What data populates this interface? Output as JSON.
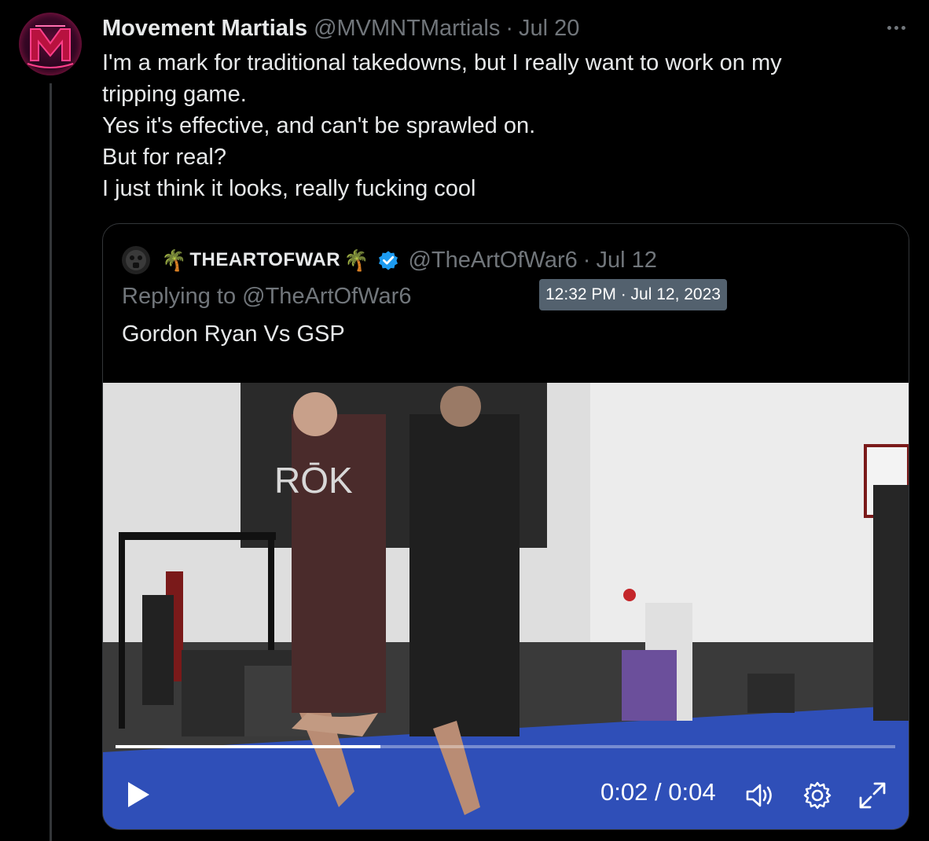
{
  "tweet": {
    "author_name": "Movement Martials",
    "author_handle": "@MVMNTMartials",
    "separator": "·",
    "date": "Jul 20",
    "avatar_icon": "mm-logo-icon",
    "more_icon": "more-icon",
    "lines": [
      "I'm a mark for traditional takedowns, but I really want to work on my",
      "tripping game.",
      "Yes it's effective, and can't be sprawled on.",
      "But for real?",
      "I just think it looks, really fucking cool"
    ]
  },
  "quote": {
    "palm_left": "🌴",
    "author_name": "THEARTOFWAR",
    "palm_right": "🌴",
    "verified_icon": "verified-badge-icon",
    "author_handle": "@TheArtOfWar6",
    "separator": "·",
    "date": "Jul 12",
    "reply_prefix": "Replying to",
    "reply_handle": "@TheArtOfWar6",
    "tooltip": "12:32 PM · Jul 12, 2023",
    "text": "Gordon Ryan Vs GSP"
  },
  "video": {
    "current_time": "0:02",
    "time_separator": "/",
    "duration": "0:04",
    "progress_fraction": 0.34,
    "colors": {
      "mat": "#2f4fb8",
      "wall": "#dcdcdc",
      "banner": "#2a2a2a"
    }
  }
}
